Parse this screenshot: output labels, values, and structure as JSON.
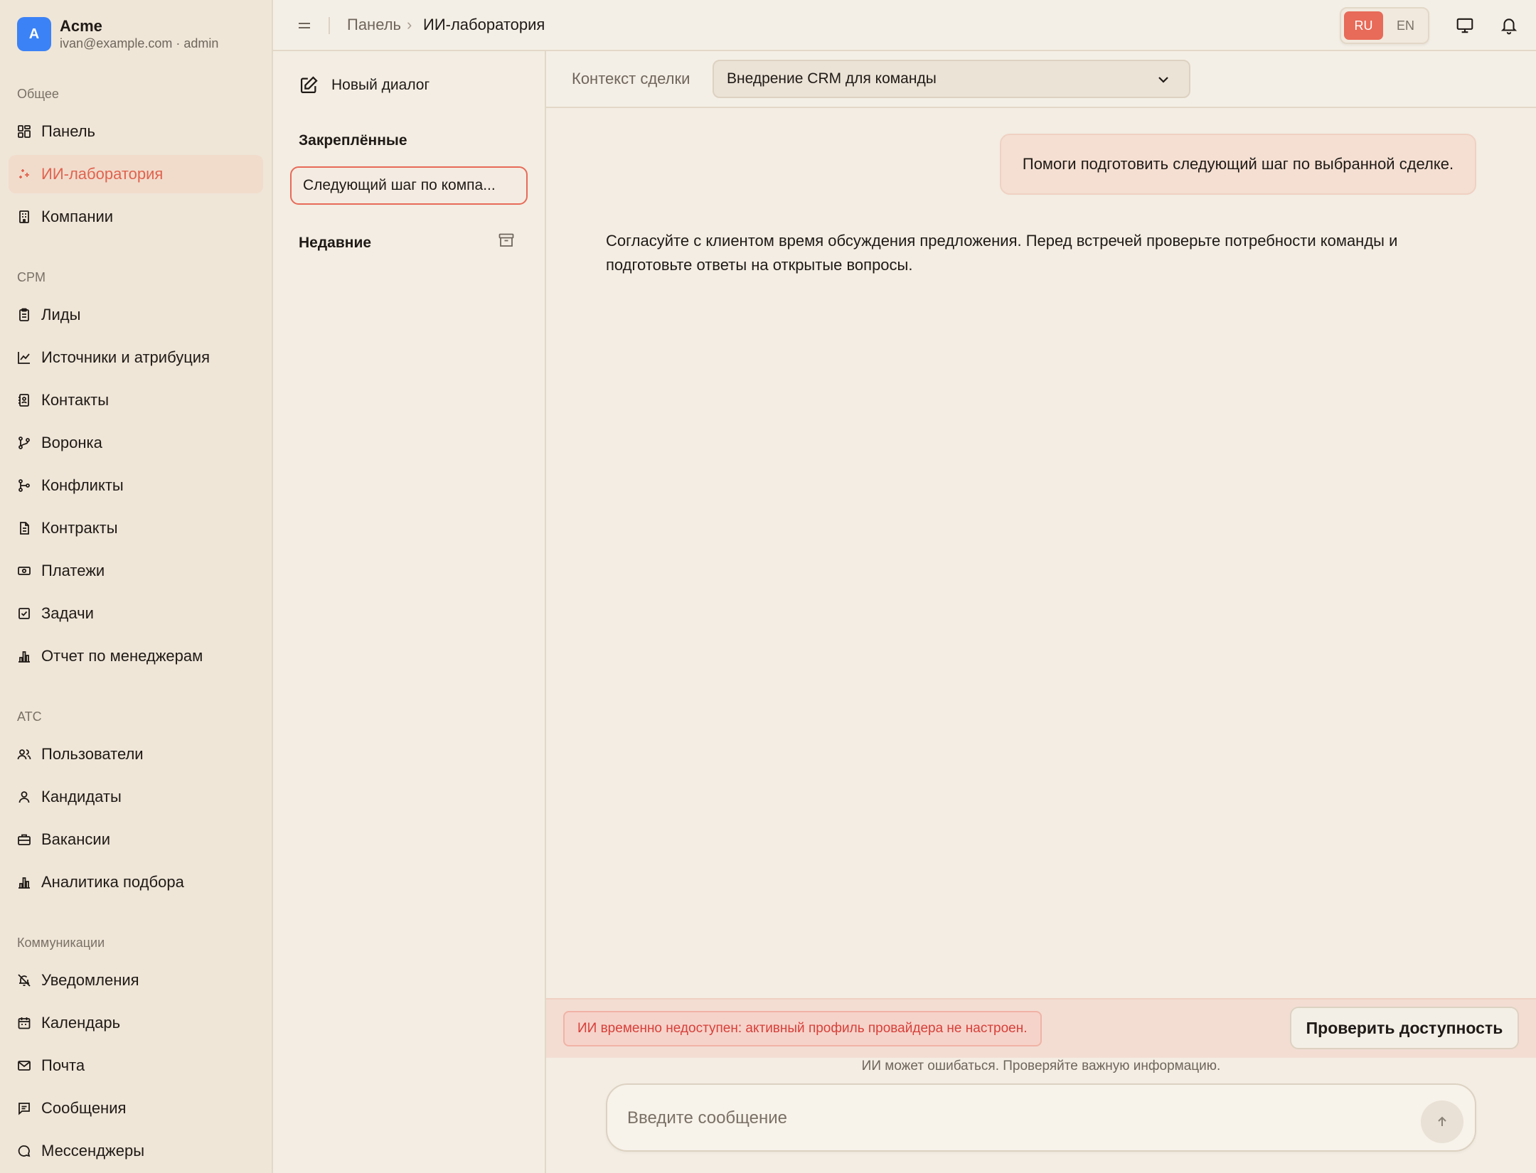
{
  "brand": {
    "initial": "A",
    "name": "Acme",
    "subtitle": "ivan@example.com · admin"
  },
  "sidebar": {
    "sections": [
      {
        "label": "Общее",
        "items": [
          {
            "label": "Панель",
            "icon": "dashboard-icon"
          },
          {
            "label": "ИИ-лаборатория",
            "icon": "sparkles-icon",
            "active": true
          },
          {
            "label": "Компании",
            "icon": "building-icon"
          }
        ]
      },
      {
        "label": "CPM",
        "items": [
          {
            "label": "Лиды",
            "icon": "clipboard-icon"
          },
          {
            "label": "Источники и атрибуция",
            "icon": "chart-line-icon"
          },
          {
            "label": "Контакты",
            "icon": "contact-book-icon"
          },
          {
            "label": "Воронка",
            "icon": "branch-icon"
          },
          {
            "label": "Конфликты",
            "icon": "merge-icon"
          },
          {
            "label": "Контракты",
            "icon": "document-icon"
          },
          {
            "label": "Платежи",
            "icon": "banknote-icon"
          },
          {
            "label": "Задачи",
            "icon": "checkbox-icon"
          },
          {
            "label": "Отчет по менеджерам",
            "icon": "bar-chart-icon"
          }
        ]
      },
      {
        "label": "ATC",
        "items": [
          {
            "label": "Пользователи",
            "icon": "users-icon"
          },
          {
            "label": "Кандидаты",
            "icon": "user-icon"
          },
          {
            "label": "Вакансии",
            "icon": "briefcase-icon"
          },
          {
            "label": "Аналитика подбора",
            "icon": "bar-chart-icon"
          }
        ]
      },
      {
        "label": "Коммуникации",
        "items": [
          {
            "label": "Уведомления",
            "icon": "bell-off-icon"
          },
          {
            "label": "Календарь",
            "icon": "calendar-icon"
          },
          {
            "label": "Почта",
            "icon": "mail-icon"
          },
          {
            "label": "Сообщения",
            "icon": "message-square-icon"
          },
          {
            "label": "Мессенджеры",
            "icon": "message-circle-icon"
          }
        ]
      }
    ]
  },
  "topbar": {
    "breadcrumb_root": "Панель",
    "breadcrumb_sep": "›",
    "breadcrumb_current": "ИИ-лаборатория",
    "lang_ru": "RU",
    "lang_en": "EN",
    "active_lang": "RU"
  },
  "chatlist": {
    "new_dialog": "Новый диалог",
    "pinned_heading": "Закреплённые",
    "pinned_item": "Следующий шаг по компа...",
    "recent_heading": "Недавние"
  },
  "context": {
    "label": "Контекст сделки",
    "selected": "Внедрение CRM для команды"
  },
  "messages": {
    "user": "Помоги подготовить следующий шаг по выбранной сделке.",
    "assistant": "Согласуйте с клиентом время обсуждения предложения. Перед встречей проверьте потребности команды и подготовьте ответы на открытые вопросы."
  },
  "error": {
    "text": "ИИ временно недоступен: активный профиль провайдера не настроен.",
    "button": "Проверить доступность"
  },
  "disclaimer": "ИИ может ошибаться. Проверяйте важную информацию.",
  "composer": {
    "placeholder": "Введите сообщение"
  },
  "colors": {
    "accent": "#e86a58",
    "brand_avatar": "#3b82f6",
    "error_text": "#d6403a"
  }
}
